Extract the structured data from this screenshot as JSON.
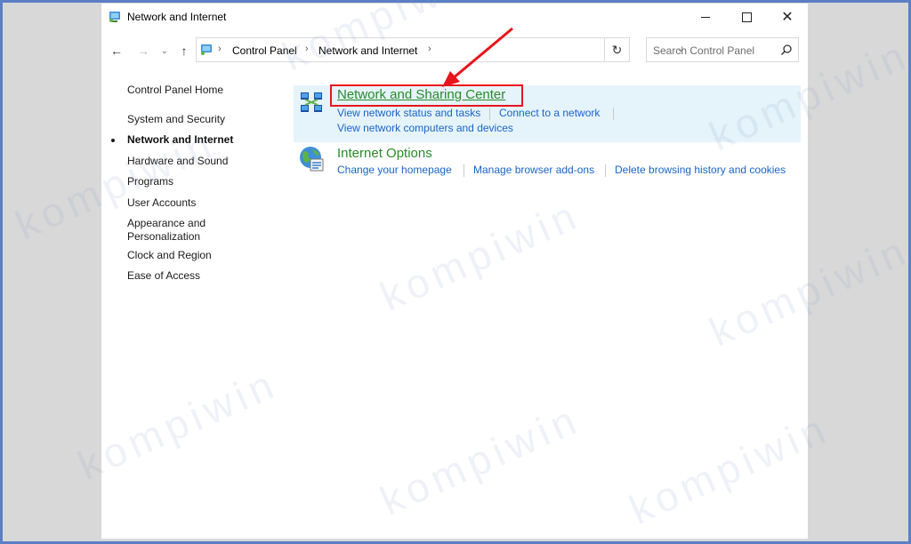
{
  "window": {
    "title": "Network and Internet",
    "search_placeholder": "Search Control Panel"
  },
  "address": {
    "crumbs": [
      "Control Panel",
      "Network and Internet"
    ]
  },
  "left_nav": {
    "home": "Control Panel Home",
    "items": [
      "System and Security",
      "Network and Internet",
      "Hardware and Sound",
      "Programs",
      "User Accounts",
      "Appearance and",
      "Personalization",
      "Clock and Region",
      "Ease of Access"
    ]
  },
  "categories": [
    {
      "title": "Network and Sharing Center",
      "tasks": [
        "View network status and tasks",
        "Connect to a network",
        "View network computers and devices"
      ]
    },
    {
      "title": "Internet Options",
      "tasks": [
        "Change your homepage",
        "Manage browser add-ons",
        "Delete browsing history and cookies"
      ]
    }
  ],
  "watermark": {
    "text": "kompiwin"
  },
  "colors": {
    "frame": "#5b7fc6",
    "category_title": "#2b8a2b",
    "task_link": "#1a64c8",
    "highlight": "#e5f3fb",
    "annotation": "#e8141c"
  }
}
